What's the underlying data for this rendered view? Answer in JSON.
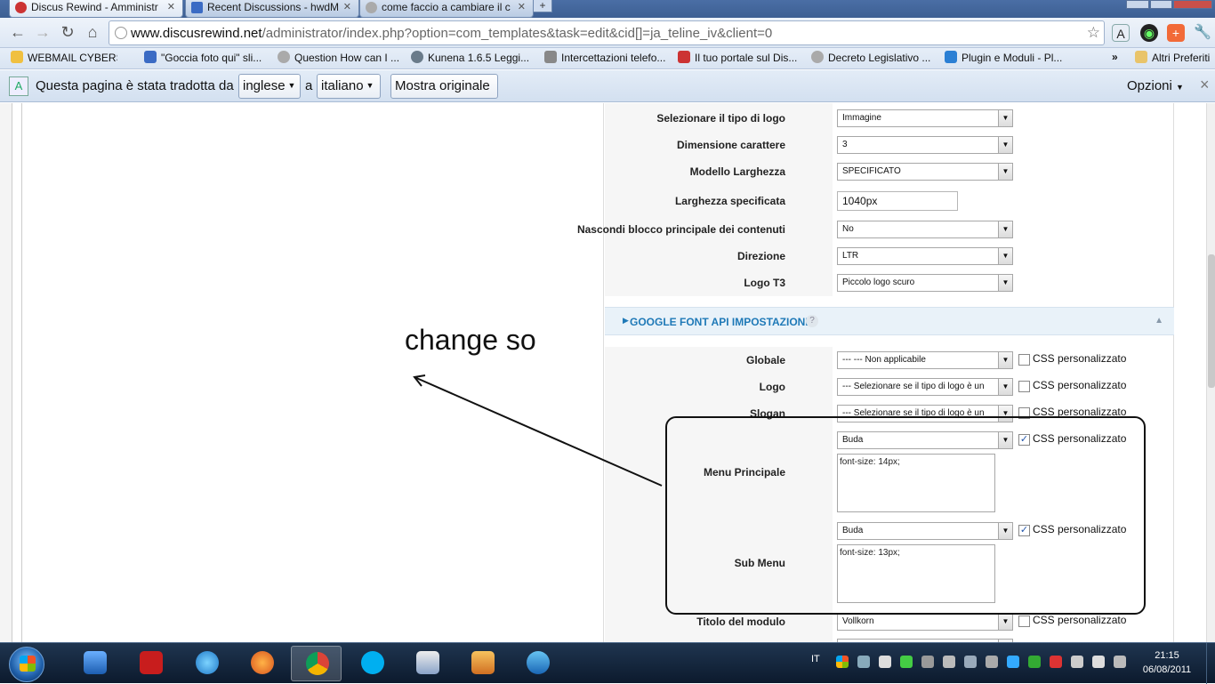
{
  "browser": {
    "tabs": [
      {
        "title": "Discus Rewind - Amministr",
        "active": true
      },
      {
        "title": "Recent Discussions - hwdM",
        "active": false
      },
      {
        "title": "come faccio a cambiare il c",
        "active": false
      }
    ],
    "new_tab_label": "+",
    "url_domain": "www.discusrewind.net",
    "url_path": "/administrator/index.php?option=com_templates&task=edit&cid[]=ja_teline_iv&client=0",
    "bookmarks": [
      "WEBMAIL CYBERS",
      "\"Goccia foto qui\" sli...",
      "Question How can I ...",
      "Kunena 1.6.5 Leggi...",
      "Intercettazioni telefo...",
      "Il tuo portale sul Dis...",
      "Decreto Legislativo ...",
      "Plugin e Moduli - Pl..."
    ],
    "bookmarks_more": "»",
    "other_bookmarks": "Altri Preferiti"
  },
  "translate_bar": {
    "text_before": "Questa pagina è stata tradotta da",
    "from_lang": "inglese",
    "connector": "a",
    "to_lang": "italiano",
    "show_original": "Mostra originale",
    "options": "Opzioni",
    "close": "×"
  },
  "settings": [
    {
      "label": "Selezionare il tipo di logo",
      "value": "Immagine"
    },
    {
      "label": "Dimensione carattere",
      "value": "3"
    },
    {
      "label": "Modello Larghezza",
      "value": "SPECIFICATO"
    },
    {
      "label": "Larghezza specificata",
      "value": "1040px"
    },
    {
      "label": "Nascondi blocco principale dei contenuti",
      "value": "No"
    },
    {
      "label": "Direzione",
      "value": "LTR"
    },
    {
      "label": "Logo T3",
      "value": "Piccolo logo scuro"
    }
  ],
  "google_font": {
    "section_title": "GOOGLE FONT API IMPOSTAZIONI",
    "help": "?",
    "css_label": "CSS personalizzato",
    "rows": [
      {
        "label": "Globale",
        "value": "--- --- Non applicabile",
        "css": ""
      },
      {
        "label": "Logo",
        "value": "--- Selezionare se il tipo di logo è un",
        "css": ""
      },
      {
        "label": "Slogan",
        "value": "--- Selezionare se il tipo di logo è un",
        "css": ""
      },
      {
        "label": "Menu Principale",
        "value": "Buda",
        "css": "font-size: 14px;"
      },
      {
        "label": "Sub Menu",
        "value": "Buda",
        "css": "font-size: 13px;"
      },
      {
        "label": "Titolo del modulo",
        "value": "Vollkorn",
        "css": ""
      }
    ]
  },
  "annotation": {
    "text": "change so"
  },
  "taskbar": {
    "language": "IT",
    "time": "21:15",
    "date": "06/08/2011"
  }
}
